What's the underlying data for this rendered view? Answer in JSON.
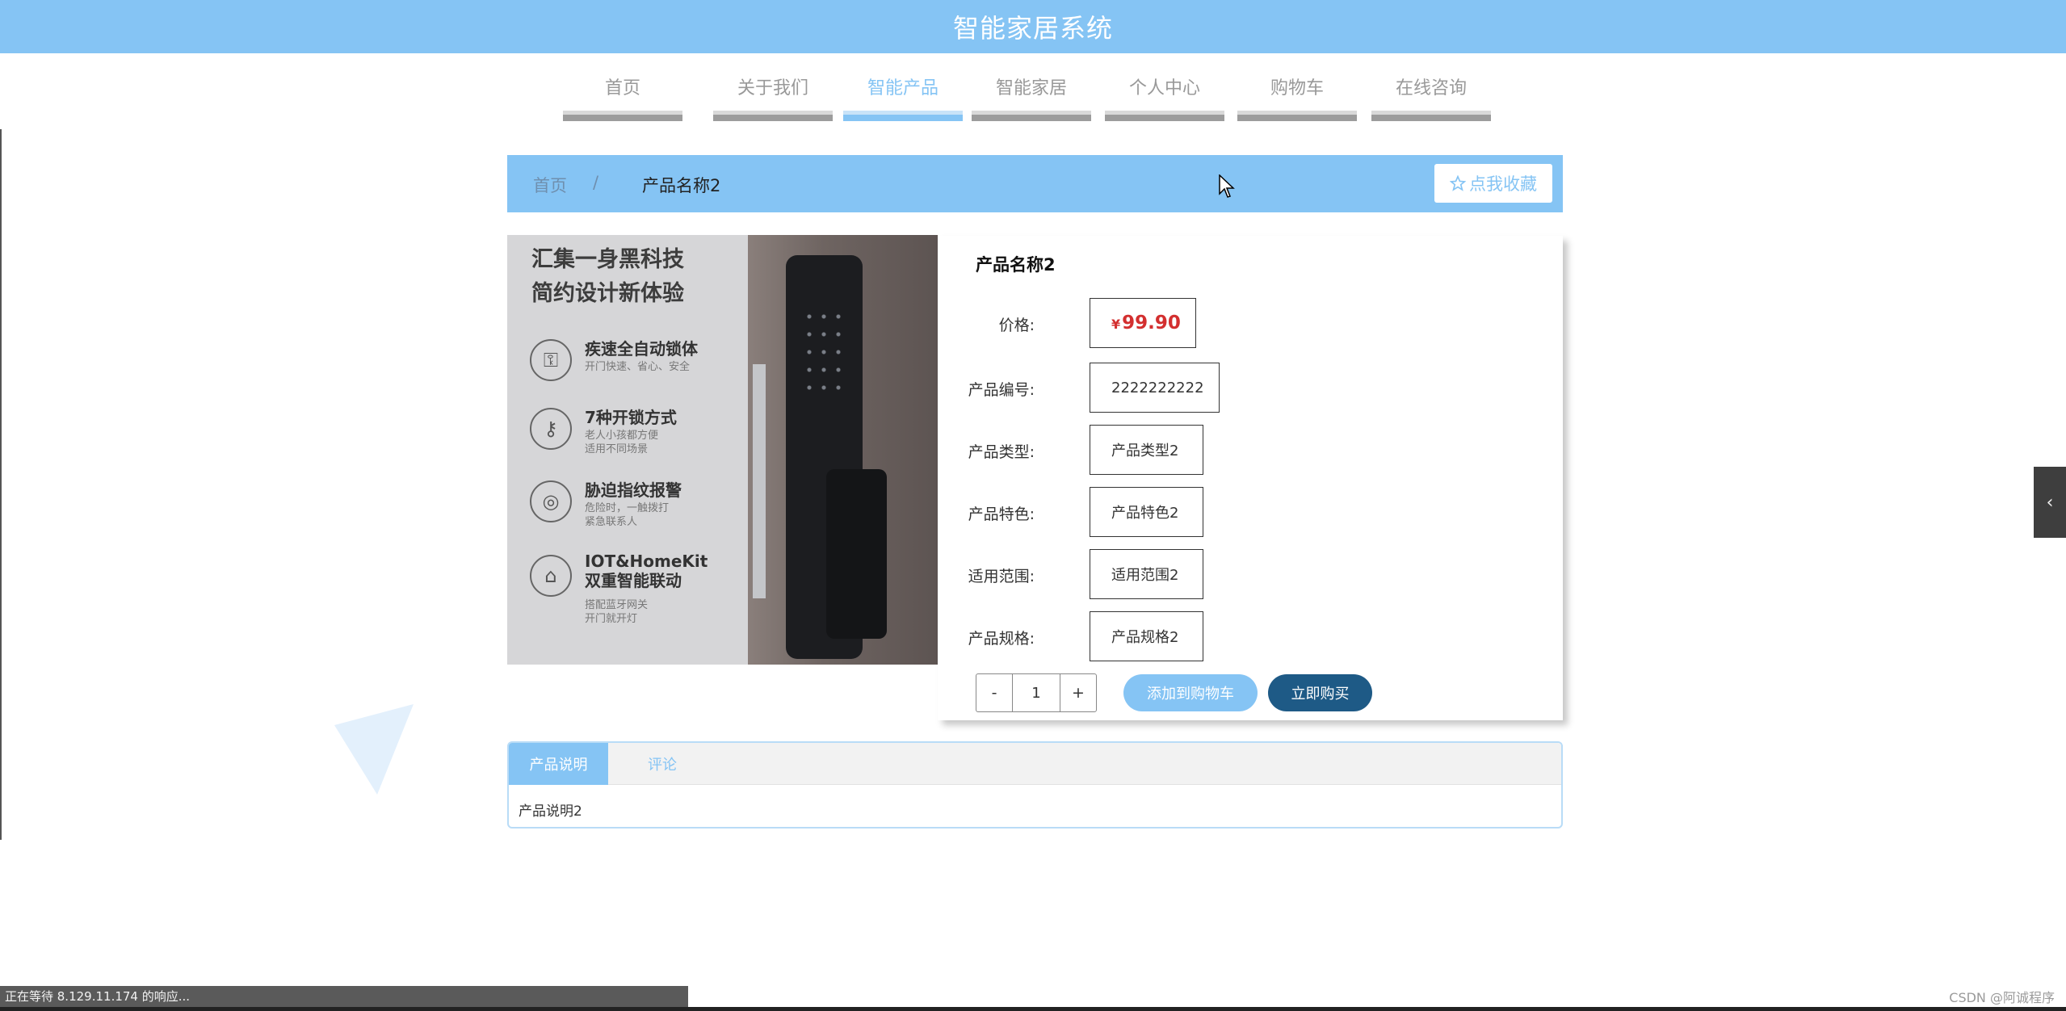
{
  "header": {
    "title": "智能家居系统"
  },
  "nav": {
    "items": [
      {
        "label": "首页",
        "active": false
      },
      {
        "label": "关于我们",
        "active": false
      },
      {
        "label": "智能产品",
        "active": true
      },
      {
        "label": "智能家居",
        "active": false
      },
      {
        "label": "个人中心",
        "active": false
      },
      {
        "label": "购物车",
        "active": false
      },
      {
        "label": "在线咨询",
        "active": false
      }
    ]
  },
  "breadcrumb": {
    "home": "首页",
    "separator": "/",
    "current": "产品名称2"
  },
  "favorite": {
    "icon": "star-outline-icon",
    "label": "点我收藏"
  },
  "image": {
    "headline_1": "汇集一身黑科技",
    "headline_2": "简约设计新体验",
    "features": [
      {
        "icon": "auto-lock-icon",
        "title": "疾速全自动锁体",
        "desc": "开门快速、省心、安全"
      },
      {
        "icon": "key-icon",
        "title": "7种开锁方式",
        "desc": "老人小孩都方便\n适用不同场景"
      },
      {
        "icon": "fingerprint-icon",
        "title": "胁迫指纹报警",
        "desc": "危险时，一触拨打\n紧急联系人"
      },
      {
        "icon": "home-icon",
        "title": "IOT&HomeKit\n双重智能联动",
        "desc": "搭配蓝牙网关\n开门就开灯"
      }
    ]
  },
  "product": {
    "name": "产品名称2",
    "price_label": "价格:",
    "currency": "¥",
    "price": "99.90",
    "fields": [
      {
        "label": "产品编号:",
        "value": "2222222222"
      },
      {
        "label": "产品类型:",
        "value": "产品类型2"
      },
      {
        "label": "产品特色:",
        "value": "产品特色2"
      },
      {
        "label": "适用范围:",
        "value": "适用范围2"
      },
      {
        "label": "产品规格:",
        "value": "产品规格2"
      }
    ],
    "quantity": {
      "minus": "-",
      "value": "1",
      "plus": "+"
    },
    "add_to_cart": "添加到购物车",
    "buy_now": "立即购买"
  },
  "tabs": {
    "items": [
      {
        "label": "产品说明",
        "active": true
      },
      {
        "label": "评论",
        "active": false
      }
    ],
    "content": "产品说明2"
  },
  "side_toggle": {
    "icon": "chevron-left-icon",
    "glyph": "‹"
  },
  "status": {
    "text": "正在等待 8.129.11.174 的响应..."
  },
  "watermark": "CSDN @阿诚程序",
  "colors": {
    "accent": "#85c4f4",
    "primary_dark": "#1e5a86",
    "price": "#d32f2f"
  }
}
